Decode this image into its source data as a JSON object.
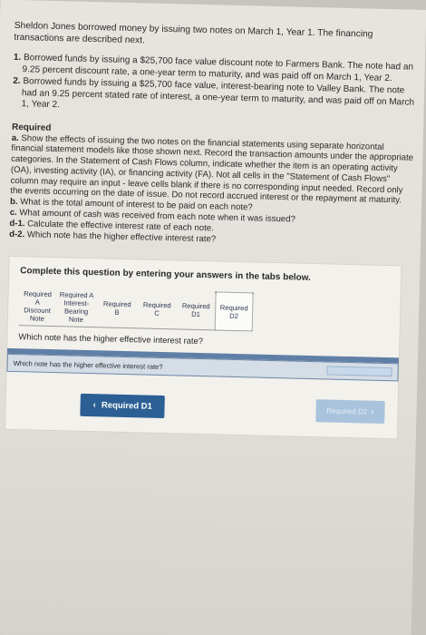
{
  "intro": "Sheldon Jones borrowed money by issuing two notes on March 1, Year 1. The financing transactions are described next.",
  "items": [
    {
      "num": "1.",
      "text": "Borrowed funds by issuing a $25,700 face value discount note to Farmers Bank. The note had an 9.25 percent discount rate, a one-year term to maturity, and was paid off on March 1, Year 2."
    },
    {
      "num": "2.",
      "text": "Borrowed funds by issuing a $25,700 face value, interest-bearing note to Valley Bank. The note had an 9.25 percent stated rate of interest, a one-year term to maturity, and was paid off on March 1, Year 2."
    }
  ],
  "required": {
    "title": "Required",
    "lines": [
      {
        "label": "a.",
        "text": "Show the effects of issuing the two notes on the financial statements using separate horizontal financial statement models like those shown next. Record the transaction amounts under the appropriate categories. In the Statement of Cash Flows column, indicate whether the item is an operating activity (OA), investing activity (IA), or financing activity (FA). Not all cells in the \"Statement of Cash Flows\" column may require an input - leave cells blank if there is no corresponding input needed. Record only the events occurring on the date of issue. Do not record accrued interest or the repayment at maturity."
      },
      {
        "label": "b.",
        "text": "What is the total amount of interest to be paid on each note?"
      },
      {
        "label": "c.",
        "text": "What amount of cash was received from each note when it was issued?"
      },
      {
        "label": "d-1.",
        "text": "Calculate the effective interest rate of each note."
      },
      {
        "label": "d-2.",
        "text": "Which note has the higher effective interest rate?"
      }
    ]
  },
  "panel": {
    "title": "Complete this question by entering your answers in the tabs below.",
    "tabs": [
      {
        "label": "Required A Discount Note",
        "active": false
      },
      {
        "label": "Required A Interest-Bearing Note",
        "active": false
      },
      {
        "label": "Required B",
        "active": false
      },
      {
        "label": "Required C",
        "active": false
      },
      {
        "label": "Required D1",
        "active": false
      },
      {
        "label": "Required D2",
        "active": true
      }
    ],
    "question": "Which note has the higher effective interest rate?",
    "answer_label": "Which note has the higher effective interest rate?",
    "answer_value": ""
  },
  "nav": {
    "prev_label": "Required D1",
    "next_label": "Required D2",
    "prev_icon": "chevron-left-icon",
    "next_icon": "chevron-right-icon"
  }
}
